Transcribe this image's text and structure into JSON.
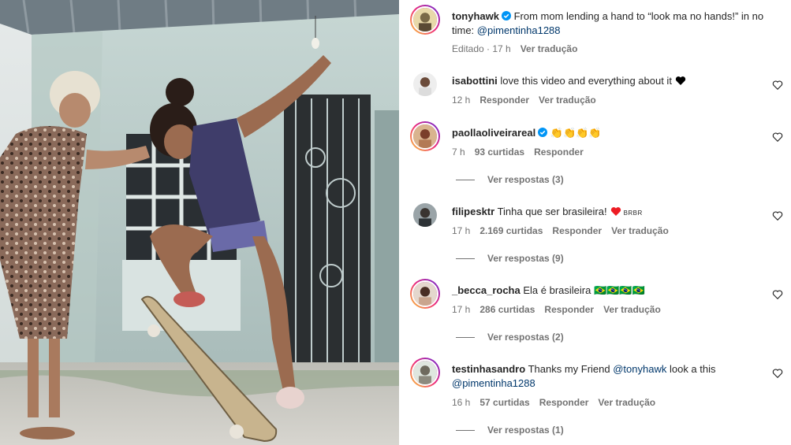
{
  "post": {
    "username": "tonyhawk",
    "caption_prefix": "From mom lending a hand to “look ma no hands!” in no time: ",
    "caption_mention": "@pimentinha1288",
    "meta_edited": "Editado · 17 h",
    "meta_translate": "Ver tradução"
  },
  "comments": [
    {
      "username": "isabottini",
      "text": "love this video and everything about it",
      "inline_heart_color": "#000000",
      "time": "12 h",
      "reply": "Responder",
      "translate": "Ver tradução"
    },
    {
      "username": "paollaoliveirareal",
      "text": "👏👏👏👏",
      "time": "7 h",
      "likes": "93 curtidas",
      "reply": "Responder",
      "view_replies": "Ver respostas (3)"
    },
    {
      "username": "filipesktr",
      "text": "Tinha que ser brasileira!",
      "inline_heart_color": "#ed1c24",
      "flag_text": "BRBR",
      "time": "17 h",
      "likes": "2.169 curtidas",
      "reply": "Responder",
      "translate": "Ver tradução",
      "view_replies": "Ver respostas (9)"
    },
    {
      "username": "_becca_rocha",
      "text": "Ela é brasileira 🇧🇷🇧🇷🇧🇷🇧🇷",
      "time": "17 h",
      "likes": "286 curtidas",
      "reply": "Responder",
      "translate": "Ver tradução",
      "view_replies": "Ver respostas (2)"
    },
    {
      "username": "testinhasandro",
      "text_prefix": "Thanks my Friend ",
      "mention1": "@tonyhawk",
      "text_mid": " look a this",
      "mention2": "@pimentinha1288",
      "time": "16 h",
      "likes": "57 curtidas",
      "reply": "Responder",
      "translate": "Ver tradução",
      "view_replies": "Ver respostas (1)"
    }
  ],
  "icons": {
    "verified": "verified-badge-icon",
    "like": "heart-outline-icon"
  },
  "colors": {
    "link": "#00376b",
    "verified": "#0095f6",
    "secondary_text": "#737373"
  }
}
